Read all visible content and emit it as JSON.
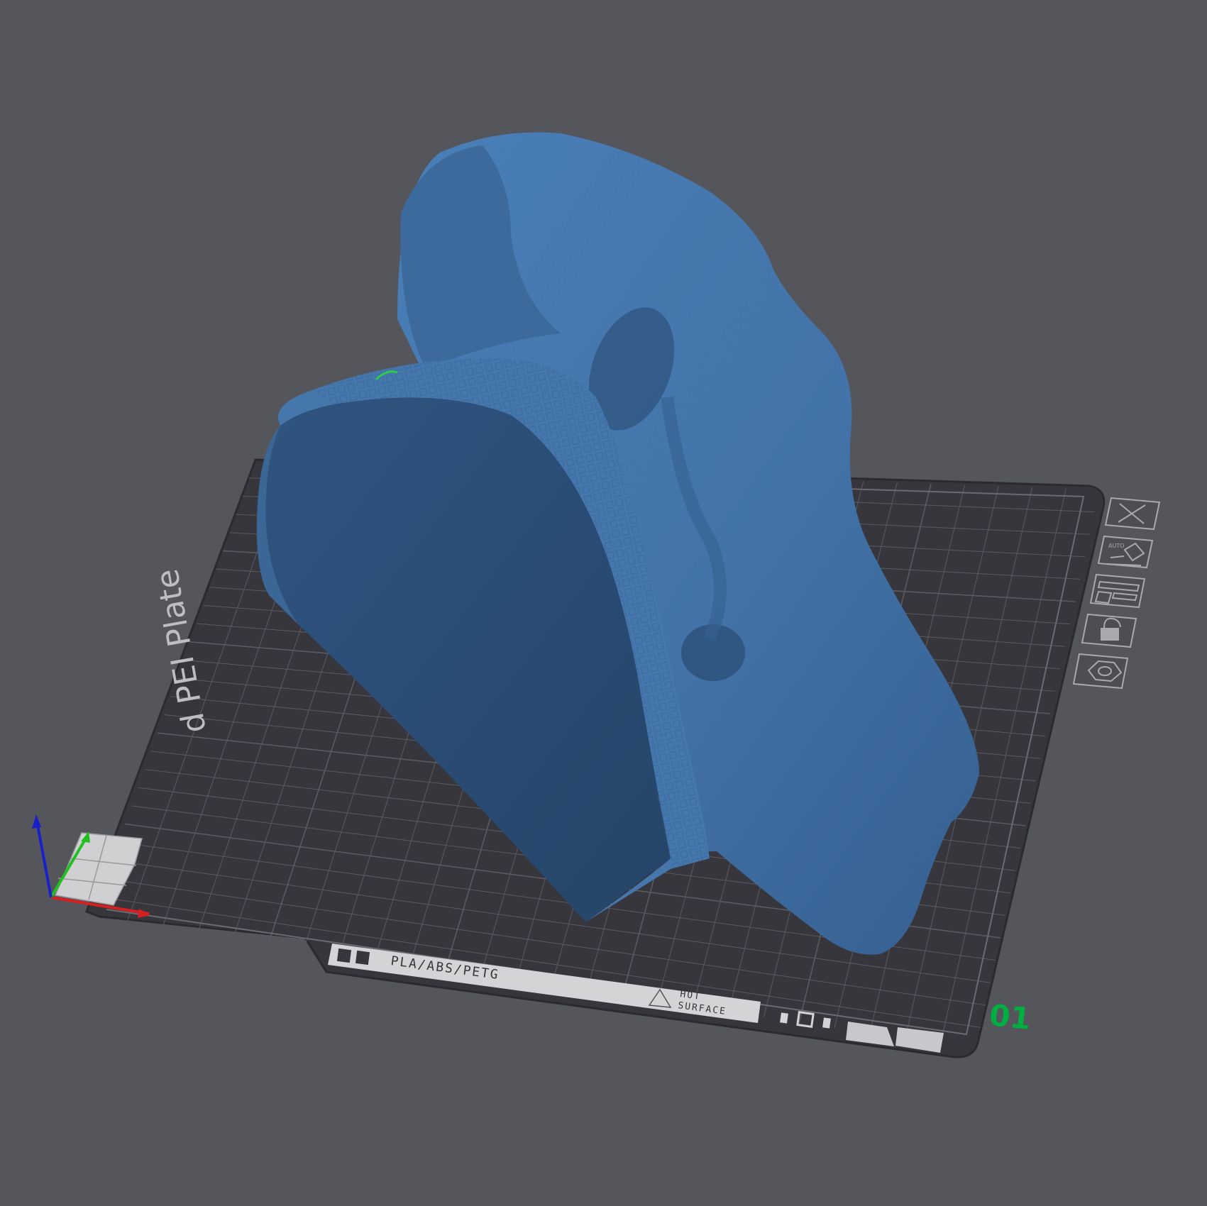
{
  "plate": {
    "name_fragment": "d PEI Plate",
    "material_label": "PLA/ABS/PETG",
    "warning_label_line1": "HOT",
    "warning_label_line2": "SURFACE",
    "plate_index": "01"
  },
  "toolbar": {
    "buttons": [
      {
        "name": "close-plate-button",
        "icon": "close-icon"
      },
      {
        "name": "auto-orient-button",
        "icon": "auto-orient-icon",
        "badge": "AUTO"
      },
      {
        "name": "arrange-button",
        "icon": "arrange-icon"
      },
      {
        "name": "lock-plate-button",
        "icon": "lock-icon"
      },
      {
        "name": "plate-settings-button",
        "icon": "gear-icon"
      }
    ]
  },
  "colors": {
    "background": "#55555c",
    "plate": "#36363c",
    "plate_edge": "#2a2a2f",
    "grid": "#5a5a62",
    "model": "#4373a8",
    "model_shadow": "#2d4f78",
    "accent_green": "#00ae42",
    "axis_x": "#d42020",
    "axis_y": "#20c020",
    "axis_z": "#1a20c8",
    "toolbar_stroke": "#a8a8ae"
  }
}
